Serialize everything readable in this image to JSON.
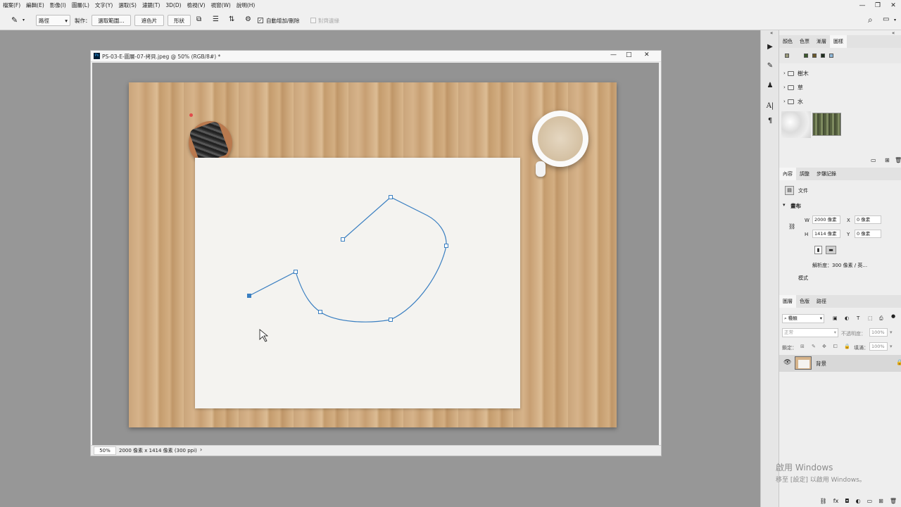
{
  "menu": [
    "檔案(F)",
    "編輯(E)",
    "影像(I)",
    "圖層(L)",
    "文字(Y)",
    "選取(S)",
    "濾鏡(T)",
    "3D(D)",
    "檢視(V)",
    "視窗(W)",
    "說明(H)"
  ],
  "window_buttons": [
    "—",
    "❐",
    "✕"
  ],
  "options": {
    "mode_select": "路徑",
    "make_label": "製作：",
    "select_btn": "選取範圍...",
    "mask_btn": "遮色片",
    "shape_btn": "形狀",
    "auto_add_delete": "自動增加/刪除",
    "align_edges": "對齊邊緣"
  },
  "document": {
    "title": "PS-03-E-圖層-07-拷貝.jpeg @ 50% (RGB/8#) *",
    "zoom": "50%",
    "info": "2000 像素 x 1414 像素 (300 ppi)",
    "buttons": [
      "—",
      "□",
      "✕"
    ]
  },
  "panel_top": {
    "tabs": [
      "顏色",
      "色票",
      "漸層",
      "圖樣"
    ],
    "active_tab": 3,
    "folders": [
      "樹木",
      "草",
      "水"
    ]
  },
  "properties": {
    "tabs": [
      "內容",
      "調整",
      "步驟記錄"
    ],
    "doc_label": "文件",
    "section": "畫布",
    "w_label": "W",
    "w_value": "2000 像素",
    "h_label": "H",
    "h_value": "1414 像素",
    "x_label": "X",
    "x_value": "0 像素",
    "y_label": "Y",
    "y_value": "0 像素",
    "resolution": "解析度：300 像素 / 英...",
    "mode_label": "模式"
  },
  "layers": {
    "tabs": [
      "圖層",
      "色版",
      "路徑"
    ],
    "filter_placeholder": "種類",
    "blend_mode": "正常",
    "opacity_label": "不透明度：",
    "opacity_value": "100%",
    "lock_label": "鎖定：",
    "fill_label": "填滿：",
    "fill_value": "100%",
    "layer_name": "背景"
  },
  "watermark": {
    "line1": "啟用 Windows",
    "line2": "移至 [設定] 以啟用 Windows。"
  },
  "colors": {
    "path": "#3a7fc1",
    "wood": "#d2ae84",
    "paper": "#f4f3f0"
  }
}
